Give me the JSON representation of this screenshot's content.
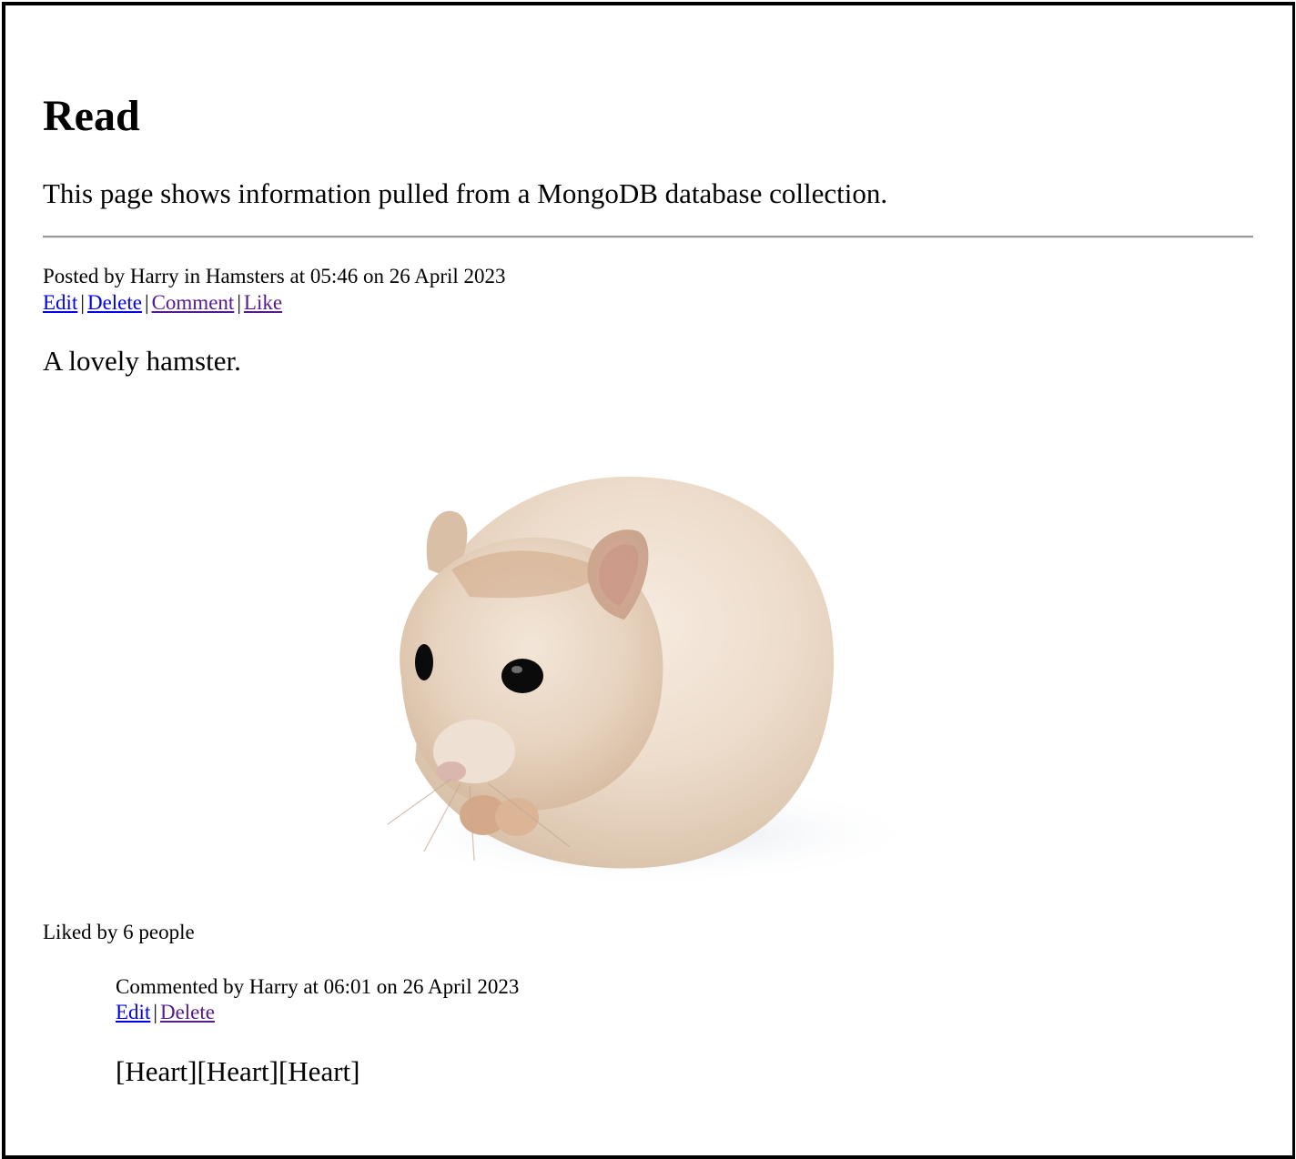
{
  "page": {
    "title": "Read",
    "intro": "This page shows information pulled from a MongoDB database collection."
  },
  "post": {
    "meta": "Posted by Harry in Hamsters at 05:46 on 26 April 2023",
    "actions": {
      "edit": "Edit",
      "delete": "Delete",
      "comment": "Comment",
      "like": "Like",
      "separator": "|"
    },
    "body": "A lovely hamster.",
    "image_icon": "hamster-photo",
    "likes": "Liked by 6 people"
  },
  "comment": {
    "meta": "Commented by Harry at 06:01 on 26 April 2023",
    "actions": {
      "edit": "Edit",
      "delete": "Delete",
      "separator": "|"
    },
    "body": "[Heart][Heart][Heart]"
  },
  "colors": {
    "link": "#0000ee",
    "visited_link": "#551a8b"
  }
}
